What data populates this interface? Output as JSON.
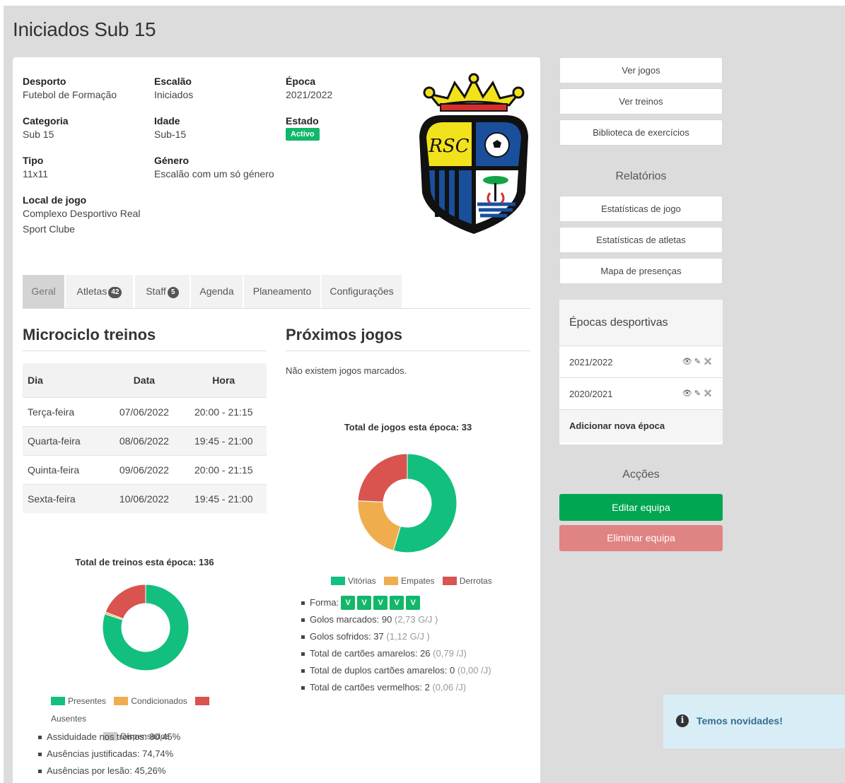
{
  "page": {
    "title": "Iniciados Sub 15"
  },
  "info": {
    "desporto": {
      "label": "Desporto",
      "value": "Futebol de Formação"
    },
    "escalao": {
      "label": "Escalão",
      "value": "Iniciados"
    },
    "epoca": {
      "label": "Época",
      "value": "2021/2022"
    },
    "categoria": {
      "label": "Categoria",
      "value": "Sub 15"
    },
    "idade": {
      "label": "Idade",
      "value": "Sub-15"
    },
    "estado": {
      "label": "Estado",
      "value": "Activo"
    },
    "tipo": {
      "label": "Tipo",
      "value": "11x11"
    },
    "genero": {
      "label": "Género",
      "value": "Escalão com um só género"
    },
    "local": {
      "label": "Local de jogo",
      "value": "Complexo Desportivo Real Sport Clube"
    },
    "crest_text": "RSC"
  },
  "tabs": [
    {
      "label": "Geral",
      "count": null
    },
    {
      "label": "Atletas",
      "count": "42"
    },
    {
      "label": "Staff",
      "count": "5"
    },
    {
      "label": "Agenda",
      "count": null
    },
    {
      "label": "Planeamento",
      "count": null
    },
    {
      "label": "Configurações",
      "count": null
    }
  ],
  "microciclo": {
    "title": "Microciclo treinos",
    "headers": [
      "Dia",
      "Data",
      "Hora"
    ],
    "rows": [
      [
        "Terça-feira",
        "07/06/2022",
        "20:00 - 21:15"
      ],
      [
        "Quarta-feira",
        "08/06/2022",
        "19:45 - 21:00"
      ],
      [
        "Quinta-feira",
        "09/06/2022",
        "20:00 - 21:15"
      ],
      [
        "Sexta-feira",
        "10/06/2022",
        "19:45 - 21:00"
      ]
    ]
  },
  "proximos": {
    "title": "Próximos jogos",
    "empty": "Não existem jogos marcados."
  },
  "chart_data": [
    {
      "type": "pie",
      "title": "Total de jogos esta época: 33",
      "categories": [
        "Vitórias",
        "Empates",
        "Derrotas"
      ],
      "values": [
        18,
        7,
        8
      ],
      "colors": [
        "#12bf7f",
        "#f0ad4e",
        "#d9534f"
      ]
    },
    {
      "type": "pie",
      "title": "Total de treinos esta época: 136",
      "categories": [
        "Presentes",
        "Condicionados",
        "Ausentes",
        "Dispensados"
      ],
      "values": [
        109,
        1,
        26,
        0
      ],
      "colors": [
        "#12bf7f",
        "#f0ad4e",
        "#d9534f",
        "#cccccc"
      ]
    }
  ],
  "jogos_stats": {
    "forma_label": "Forma:",
    "forma": [
      "V",
      "V",
      "V",
      "V",
      "V"
    ],
    "lines": [
      {
        "text": "Golos marcados: 90",
        "muted": "(2,73 G/J )"
      },
      {
        "text": "Golos sofridos: 37",
        "muted": "(1,12 G/J )"
      },
      {
        "text": "Total de cartões amarelos: 26",
        "muted": "(0,79 /J)"
      },
      {
        "text": "Total de duplos cartões amarelos: 0",
        "muted": "(0,00 /J)"
      },
      {
        "text": "Total de cartões vermelhos: 2",
        "muted": "(0,06 /J)"
      }
    ]
  },
  "treinos_stats": [
    "Assiduidade nos treinos: 80,45%",
    "Ausências justificadas: 74,74%",
    "Ausências por lesão: 45,26%"
  ],
  "sidebar": {
    "buttons": [
      "Ver jogos",
      "Ver treinos",
      "Biblioteca de exercícios"
    ],
    "relatorios_title": "Relatórios",
    "relatorios": [
      "Estatísticas de jogo",
      "Estatísticas de atletas",
      "Mapa de presenças"
    ],
    "epocas_title": "Épocas desportivas",
    "epocas": [
      "2021/2022",
      "2020/2021"
    ],
    "add_epoca": "Adicionar nova época",
    "accoes_title": "Acções",
    "edit": "Editar equipa",
    "delete": "Eliminar equipa"
  },
  "toast": {
    "text": "Temos novidades!"
  }
}
